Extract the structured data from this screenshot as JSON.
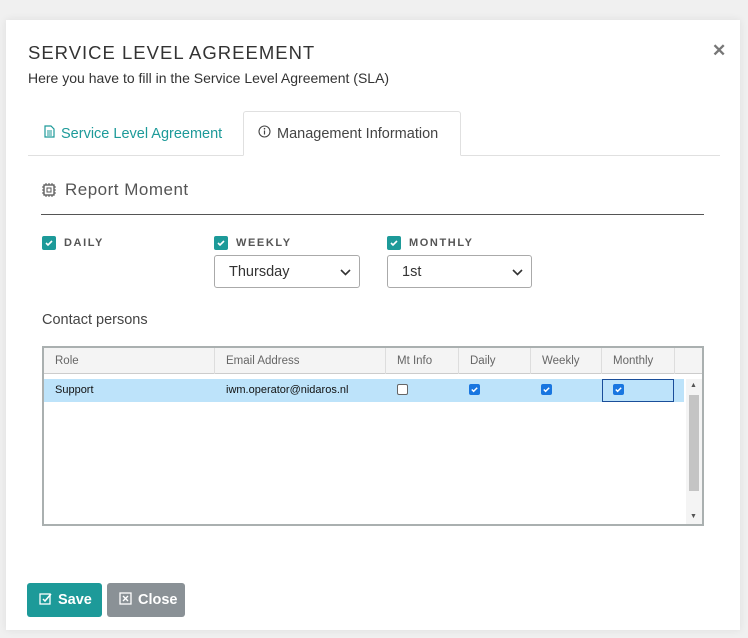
{
  "dialog": {
    "title": "SERVICE LEVEL AGREEMENT",
    "subtitle": "Here you have to fill in the Service Level Agreement (SLA)"
  },
  "tabs": [
    {
      "label": "Service Level Agreement",
      "icon": "document-icon",
      "active": false
    },
    {
      "label": "Management Information",
      "icon": "info-icon",
      "active": true
    }
  ],
  "report": {
    "title": "Report Moment",
    "icon": "chip-icon",
    "daily": {
      "label": "DAILY",
      "checked": true
    },
    "weekly": {
      "label": "WEEKLY",
      "checked": true,
      "value": "Thursday"
    },
    "monthly": {
      "label": "MONTHLY",
      "checked": true,
      "value": "1st"
    }
  },
  "contacts": {
    "label": "Contact persons",
    "columns": [
      "Role",
      "Email Address",
      "Mt Info",
      "Daily",
      "Weekly",
      "Monthly"
    ],
    "rows": [
      {
        "role": "Support",
        "email": "iwm.operator@nidaros.nl",
        "mt_info": false,
        "daily": true,
        "weekly": true,
        "monthly": true
      }
    ]
  },
  "buttons": {
    "save": "Save",
    "close": "Close"
  },
  "colors": {
    "accent": "#1d9a99",
    "secondary": "#8a9196",
    "selected_row": "#bde3fa",
    "checkbox_blue": "#1976e0"
  }
}
